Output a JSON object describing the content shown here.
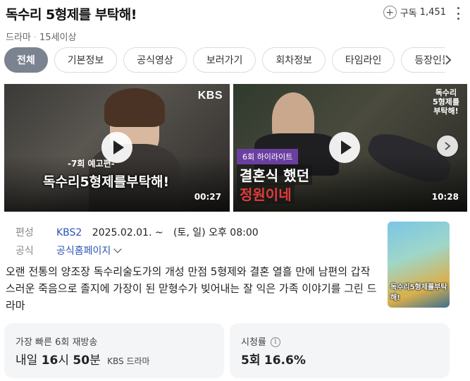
{
  "header": {
    "title": "독수리 5형제를 부탁해!",
    "genre": "드라마",
    "rating": "15세이상",
    "subscribe_label": "구독",
    "subscribe_count": "1,451"
  },
  "tabs": [
    {
      "label": "전체",
      "active": true
    },
    {
      "label": "기본정보"
    },
    {
      "label": "공식영상"
    },
    {
      "label": "보러가기"
    },
    {
      "label": "회차정보"
    },
    {
      "label": "타임라인"
    },
    {
      "label": "등장인물"
    }
  ],
  "videos": [
    {
      "channel": "KBS",
      "caption_small": "-7회 예고편-",
      "caption_big": "독수리5형제를부탁해!",
      "duration": "00:27"
    },
    {
      "episode_tag": "6회 하이라이트",
      "caption_line1": "결혼식 했던",
      "caption_line2": "정원이네",
      "duration": "10:28",
      "logo": "독수리 5형제를 부탁해!"
    }
  ],
  "info": {
    "broadcast_label": "편성",
    "channel": "KBS2",
    "start_date": "2025.02.01. ~",
    "schedule": "(토, 일) 오후 08:00",
    "official_label": "공식",
    "homepage_link": "공식홈페이지"
  },
  "poster": {
    "title": "독수리5형제를부탁해!"
  },
  "description": "오랜 전통의 양조장 독수리술도가의 개성 만점 5형제와 결혼 열흘 만에 남편의 갑작스러운 죽음으로 졸지에 가장이 된 맏형수가 빚어내는 잘 익은 가족 이야기를 그린 드라마",
  "rerun": {
    "label": "가장 빠른 6회 재방송",
    "day": "내일",
    "hour": "16",
    "hour_unit": "시",
    "minute": "50",
    "minute_unit": "분",
    "channel": "KBS 드라마"
  },
  "ratings": {
    "label": "시청률",
    "episode": "5회",
    "value": "16.6%"
  },
  "colors": {
    "active_tab": "#7b8390",
    "link": "#2a55b4",
    "card_bg": "#f4f5f7"
  }
}
